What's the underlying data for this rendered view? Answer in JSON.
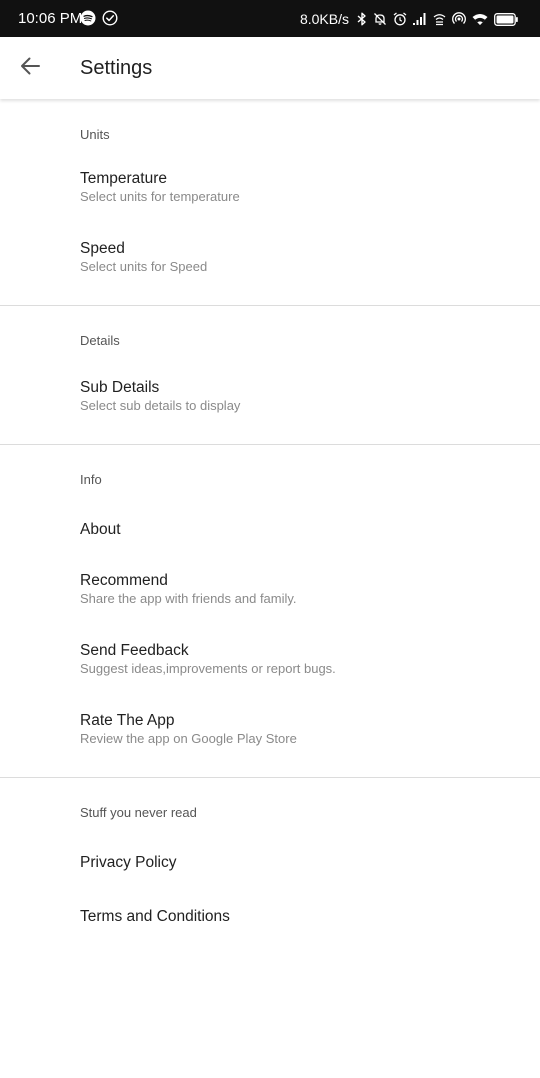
{
  "status_bar": {
    "time": "10:06 PM",
    "net_speed": "8.0KB/s",
    "left_icons": [
      "spotify-icon",
      "check-circle-icon"
    ],
    "right_icons": [
      "bluetooth-icon",
      "mute-bell-icon",
      "alarm-icon",
      "signal-icon",
      "wifi-hotspot-icon",
      "hotspot-icon",
      "wifi-icon",
      "battery-icon"
    ],
    "background": "#111111"
  },
  "app_bar": {
    "title": "Settings",
    "back_icon": "arrow-back-icon"
  },
  "sections": {
    "units": {
      "header": "Units",
      "items": [
        {
          "title": "Temperature",
          "summary": "Select units for temperature"
        },
        {
          "title": "Speed",
          "summary": "Select units for Speed"
        }
      ]
    },
    "details": {
      "header": "Details",
      "items": [
        {
          "title": "Sub Details",
          "summary": "Select sub details to display"
        }
      ]
    },
    "info": {
      "header": "Info",
      "items": [
        {
          "title": "About"
        },
        {
          "title": "Recommend",
          "summary": "Share the app with friends and family."
        },
        {
          "title": "Send Feedback",
          "summary": "Suggest ideas,improvements or report bugs."
        },
        {
          "title": "Rate The App",
          "summary": "Review the app on Google Play Store"
        }
      ]
    },
    "legal": {
      "header": "Stuff you never read",
      "items": [
        {
          "title": "Privacy Policy"
        },
        {
          "title": "Terms and Conditions"
        }
      ]
    }
  }
}
